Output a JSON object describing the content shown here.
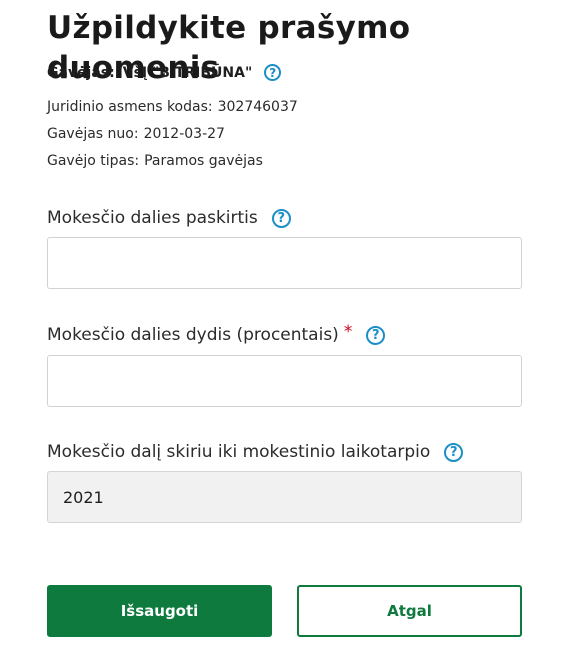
{
  "page": {
    "title": "Užpildykite prašymo duomenis"
  },
  "recipient": {
    "label": "Gavėjas:",
    "name": "VšĮ \"B TRIBŪNA\"",
    "help_icon": "question-circle-icon"
  },
  "info": [
    {
      "label": "Juridinio asmens kodas:",
      "value": "302746037"
    },
    {
      "label": "Gavėjas nuo:",
      "value": "2012-03-27"
    },
    {
      "label": "Gavėjo tipas:",
      "value": "Paramos gavėjas"
    }
  ],
  "fields": {
    "purpose": {
      "label": "Mokesčio dalies paskirtis",
      "value": "",
      "required": false
    },
    "percent": {
      "label": "Mokesčio dalies dydis (procentais)",
      "value": "",
      "required": true,
      "required_mark": "*"
    },
    "until_year": {
      "label": "Mokesčio dalį skiriu iki mokestinio laikotarpio",
      "value": "2021"
    }
  },
  "buttons": {
    "save": "Išsaugoti",
    "back": "Atgal"
  },
  "colors": {
    "primary_green": "#0f7a3e",
    "help_blue": "#1a8fc7",
    "required_red": "#d0021b"
  }
}
